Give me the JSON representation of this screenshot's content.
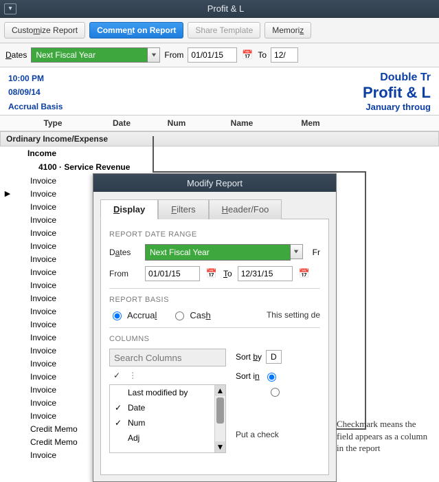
{
  "window": {
    "title": "Profit & L"
  },
  "toolbar": {
    "customize": "Customize Report",
    "comment": "Comment on Report",
    "share": "Share Template",
    "memorize": "Memoriz"
  },
  "filter": {
    "dates_label": "Dates",
    "dates_value": "Next Fiscal Year",
    "from_label": "From",
    "from_value": "01/01/15",
    "to_label": "To",
    "to_value": "12/"
  },
  "meta": {
    "time": "10:00 PM",
    "date": "08/09/14",
    "basis": "Accrual Basis",
    "brand": "Double Tr",
    "report_name": "Profit & L",
    "period": "January throug"
  },
  "columns": [
    "Type",
    "Date",
    "Num",
    "Name",
    "Mem"
  ],
  "section": {
    "band": "Ordinary Income/Expense",
    "income": "Income",
    "account": "4100 · Service Revenue"
  },
  "rows": [
    "Invoice",
    "Invoice",
    "Invoice",
    "Invoice",
    "Invoice",
    "Invoice",
    "Invoice",
    "Invoice",
    "Invoice",
    "Invoice",
    "Invoice",
    "Invoice",
    "Invoice",
    "Invoice",
    "Invoice",
    "Invoice",
    "Invoice",
    "Invoice",
    "Invoice",
    "Credit Memo",
    "Credit Memo",
    "Invoice"
  ],
  "modal": {
    "title": "Modify Report",
    "tabs": {
      "display": "Display",
      "filters": "Filters",
      "header": "Header/Foo"
    },
    "range_label": "REPORT DATE RANGE",
    "dates_label": "Dates",
    "dates_value": "Next Fiscal Year",
    "from_label": "From",
    "from_value": "01/01/15",
    "to_label": "To",
    "to_value": "12/31/15",
    "from_trail": "Fr",
    "basis_label": "REPORT BASIS",
    "accrual": "Accrual",
    "cash": "Cash",
    "basis_note": "This setting de",
    "columns_label": "COLUMNS",
    "search_placeholder": "Search Columns",
    "sort_by": "Sort by",
    "sort_by_val": "D",
    "sort_in": "Sort in",
    "items": [
      {
        "checked": false,
        "label": "Last modified by"
      },
      {
        "checked": true,
        "label": "Date"
      },
      {
        "checked": true,
        "label": "Num"
      },
      {
        "checked": false,
        "label": "Adj"
      }
    ],
    "foot_note": "Put a check"
  },
  "callout": "Checkmark means the field appears as a column in the report"
}
